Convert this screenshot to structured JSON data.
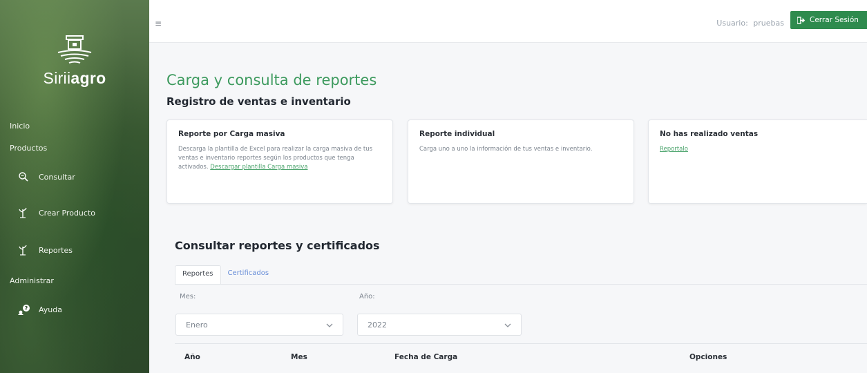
{
  "sidebar": {
    "brand_prefix": "Sirii",
    "brand_bold": "agro",
    "heading_inicio": "Inicio",
    "heading_productos": "Productos",
    "heading_administrar": "Administrar",
    "items": [
      {
        "label": "Consultar",
        "icon": "search-icon"
      },
      {
        "label": "Crear Producto",
        "icon": "plant-icon"
      },
      {
        "label": "Reportes",
        "icon": "plant-icon"
      },
      {
        "label": "Ayuda",
        "icon": "help-icon"
      }
    ]
  },
  "topbar": {
    "menu_icon": "≡",
    "user_label": "Usuario:",
    "username": "pruebas",
    "logout_label": "Cerrar Sesión"
  },
  "main": {
    "title": "Carga y consulta de reportes",
    "subtitle": "Registro de ventas e inventario",
    "cards": [
      {
        "title": "Reporte por Carga masiva",
        "text": "Descarga la plantilla de Excel para realizar la carga masiva de tus ventas e inventario reportes según los productos que tenga activados.",
        "link": "Descargar plantilla Carga masiva"
      },
      {
        "title": "Reporte individual",
        "text": "Carga uno a uno la información de tus ventas e inventario."
      },
      {
        "title": "No has realizado ventas",
        "link": "Reportalo"
      }
    ],
    "section_title": "Consultar reportes y certificados",
    "tabs": [
      {
        "label": "Reportes",
        "active": true
      },
      {
        "label": "Certificados",
        "active": false
      }
    ],
    "filters": {
      "month_label": "Mes:",
      "month_value": "Enero",
      "year_label": "Año:",
      "year_value": "2022"
    },
    "table_headers": [
      "Año",
      "Mes",
      "Fecha de Carga",
      "Opciones"
    ]
  },
  "colors": {
    "accent_green": "#3d9a5e",
    "button_green": "#2e8b4e",
    "link_blue": "#6a8fd8"
  }
}
